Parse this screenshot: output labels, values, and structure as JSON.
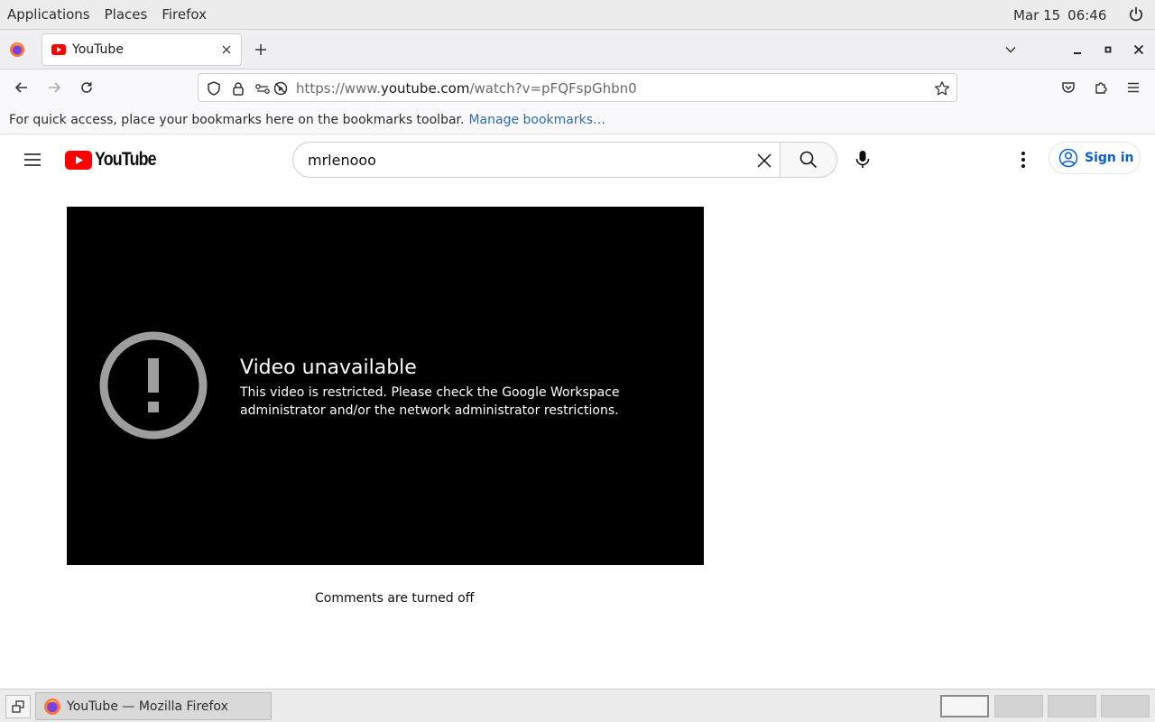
{
  "system": {
    "menus": [
      "Applications",
      "Places",
      "Firefox"
    ],
    "date": "Mar 15",
    "time": "06:46"
  },
  "browser": {
    "tab_title": "YouTube",
    "url_prefix": "https://www.",
    "url_host": "youtube.com",
    "url_path": "/watch?v=pFQFspGhbn0",
    "bookmarks_prompt": "For quick access, place your bookmarks here on the bookmarks toolbar.",
    "manage_bookmarks": "Manage bookmarks…"
  },
  "youtube": {
    "logo_text": "YouTube",
    "search_value": "mrlenooo",
    "sign_in": "Sign in",
    "brand_color": "#ff0000",
    "link_color": "#065fd4"
  },
  "player": {
    "title": "Video unavailable",
    "message": "This video is restricted. Please check the Google Workspace administrator and/or the network administrator restrictions."
  },
  "comments_status": "Comments are turned off",
  "taskbar": {
    "window_title": "YouTube — Mozilla Firefox"
  }
}
